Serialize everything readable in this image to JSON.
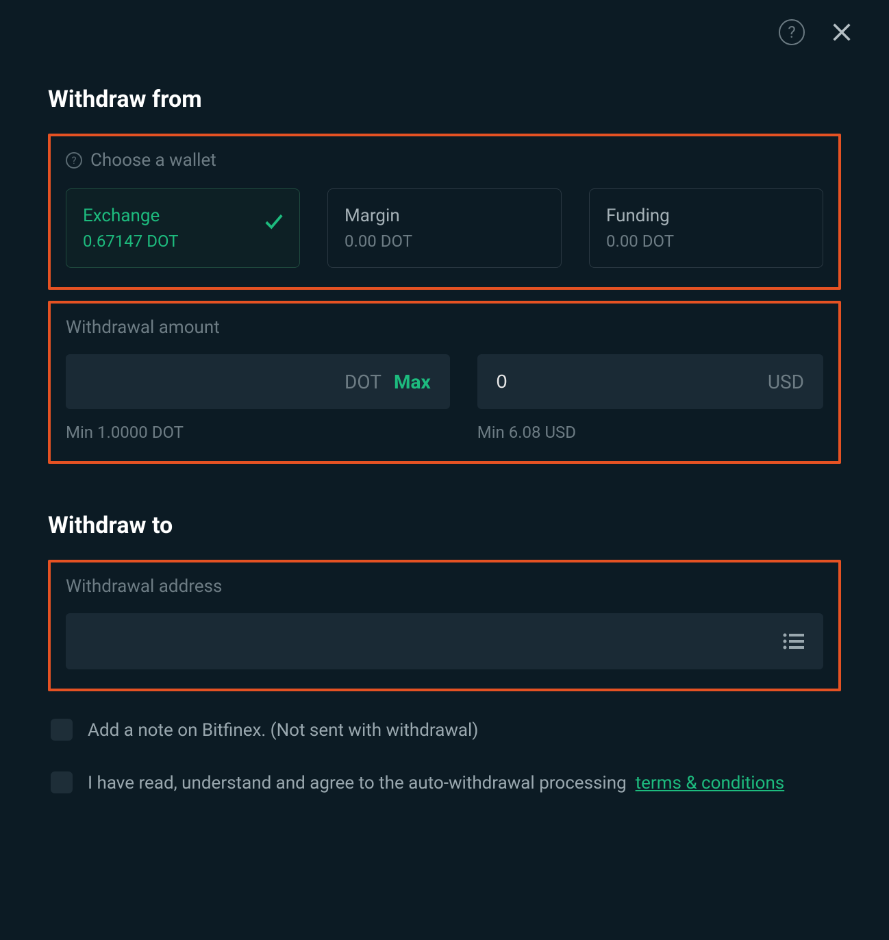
{
  "titles": {
    "withdraw_from": "Withdraw from",
    "withdraw_to": "Withdraw to"
  },
  "wallet_section": {
    "label": "Choose a wallet",
    "cards": [
      {
        "name": "Exchange",
        "balance": "0.67147 DOT",
        "selected": true
      },
      {
        "name": "Margin",
        "balance": "0.00 DOT",
        "selected": false
      },
      {
        "name": "Funding",
        "balance": "0.00 DOT",
        "selected": false
      }
    ]
  },
  "amount_section": {
    "label": "Withdrawal amount",
    "crypto": {
      "value": "",
      "currency": "DOT",
      "max_label": "Max",
      "min": "Min 1.0000 DOT"
    },
    "fiat": {
      "value": "0",
      "currency": "USD",
      "min": "Min 6.08 USD"
    }
  },
  "address_section": {
    "label": "Withdrawal address",
    "value": ""
  },
  "checkboxes": {
    "note_label": "Add a note on Bitfinex. (Not sent with withdrawal)",
    "agree_prefix": "I have read, understand and agree to the auto-withdrawal processing ",
    "terms_label": "terms & conditions"
  }
}
